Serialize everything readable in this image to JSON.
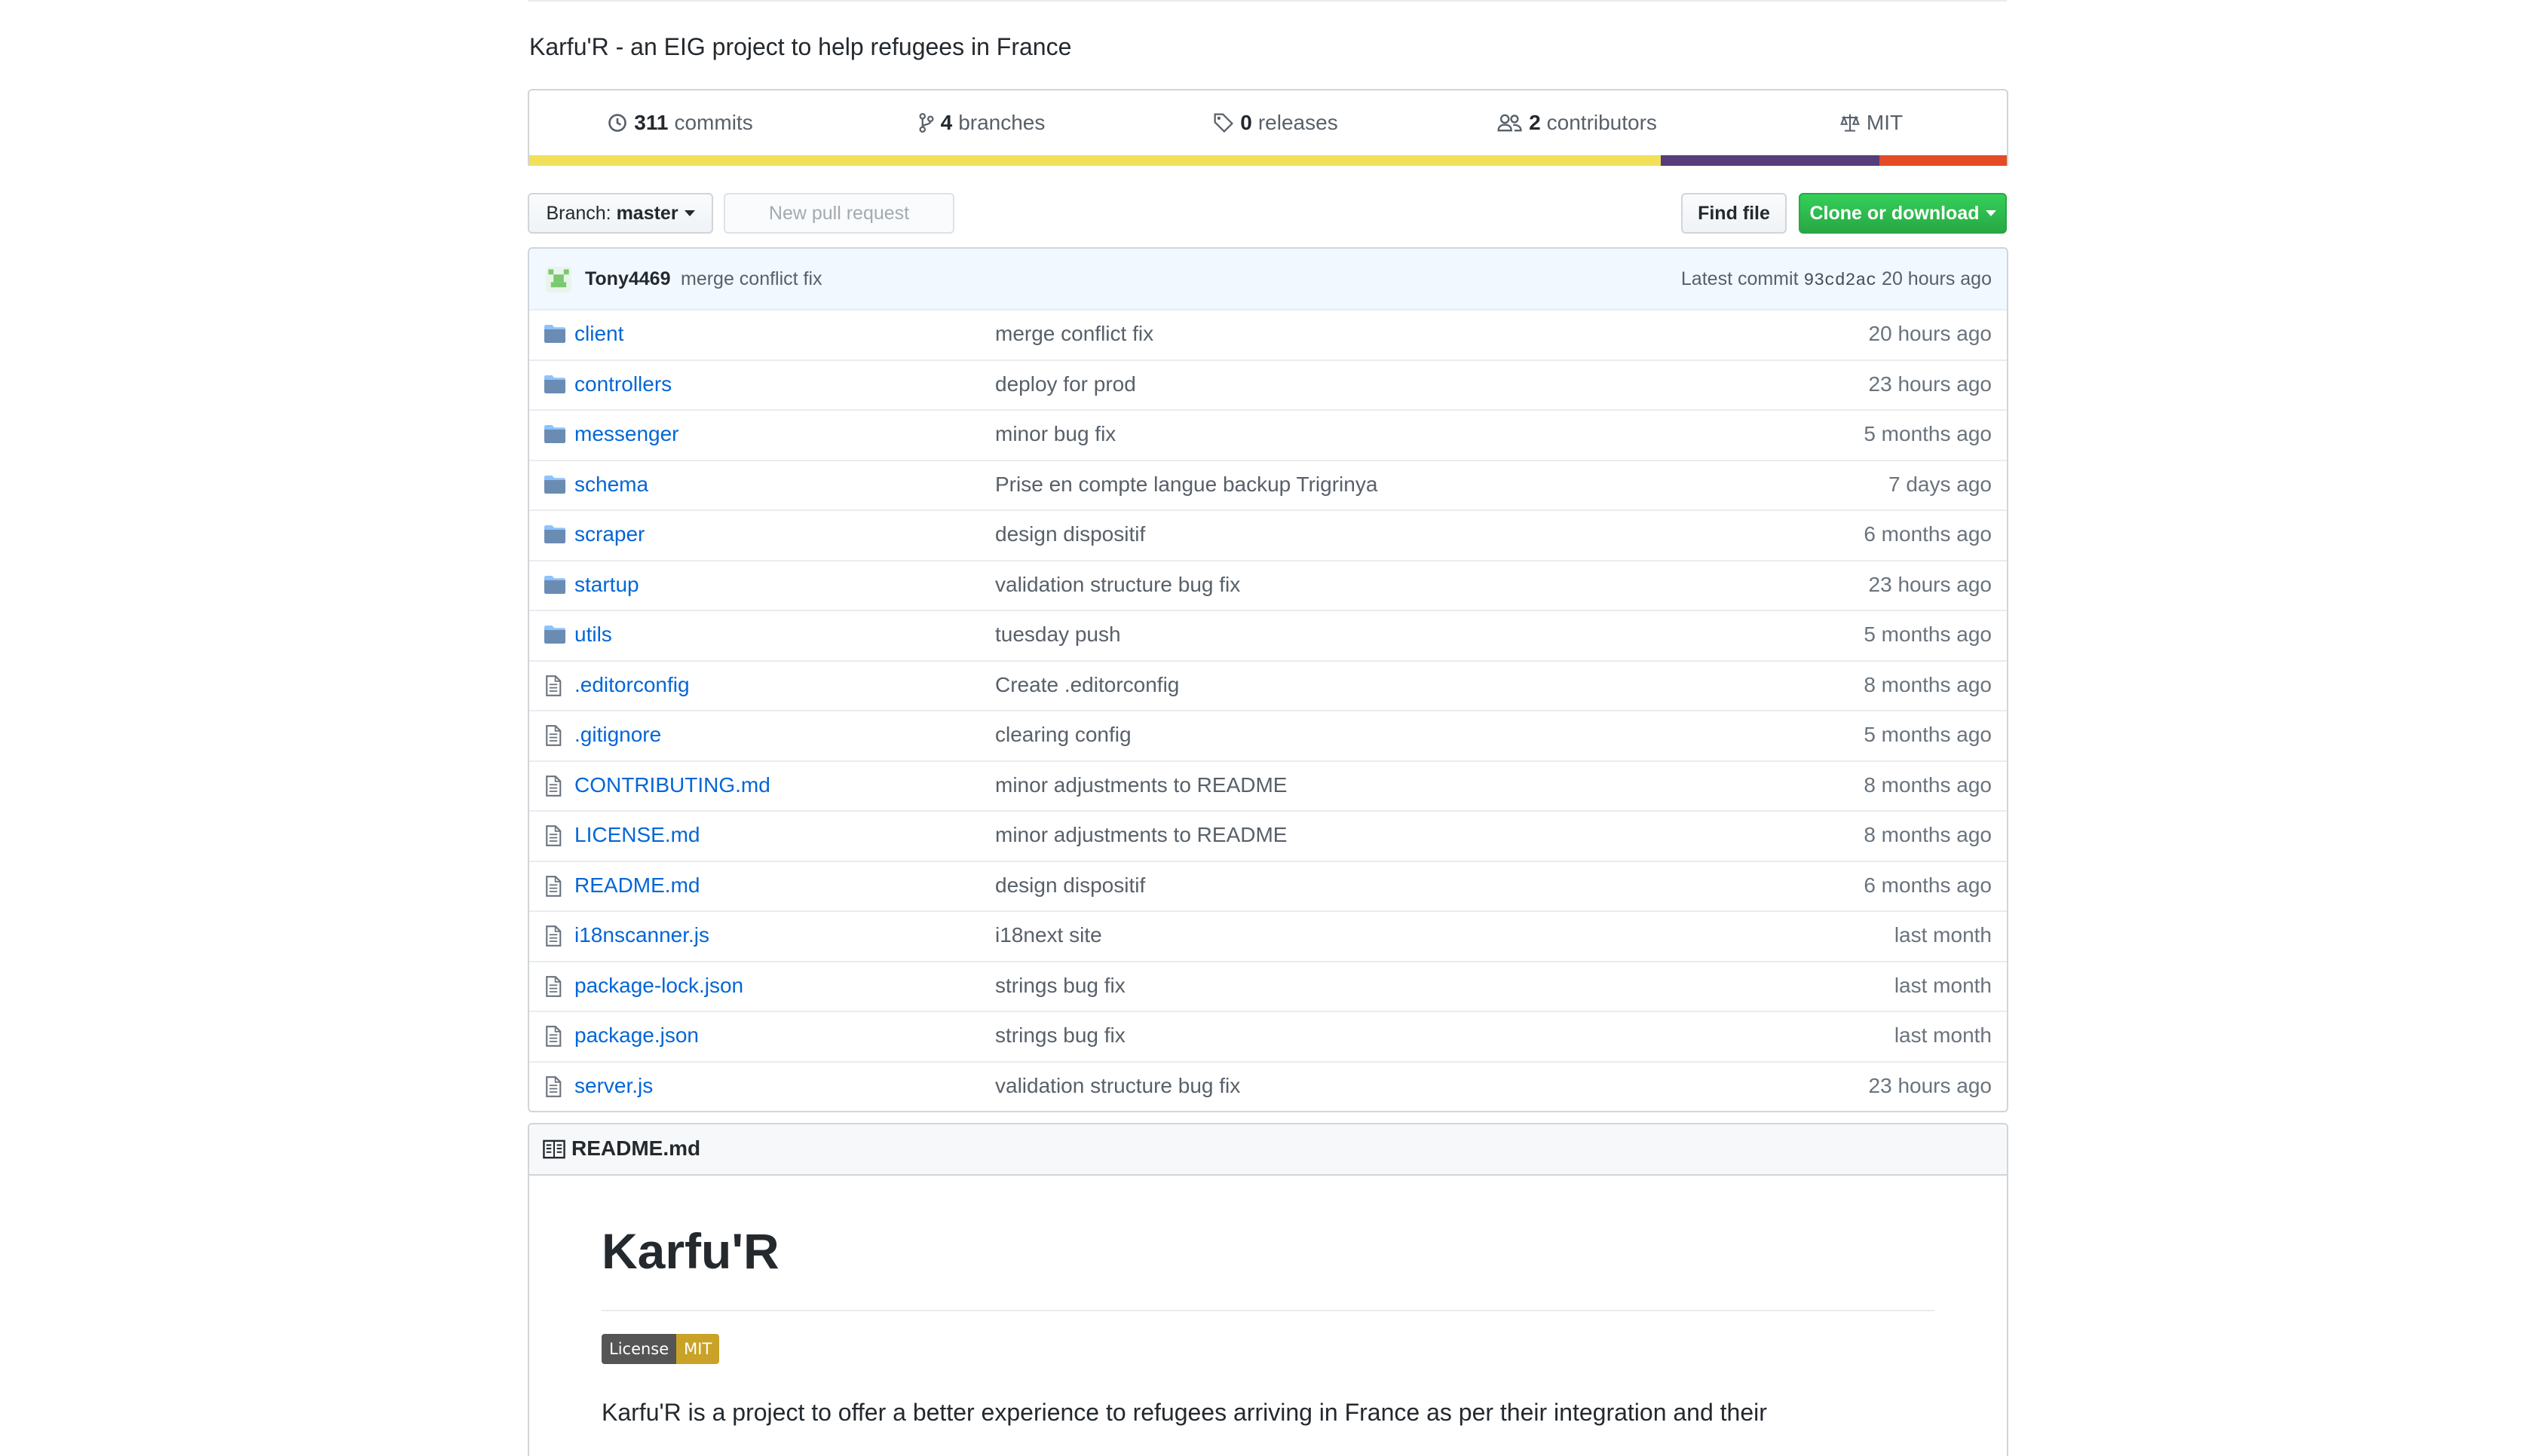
{
  "repo": {
    "description": "Karfu'R - an EIG project to help refugees in France"
  },
  "summary": {
    "commits": {
      "count": "311",
      "label": "commits"
    },
    "branches": {
      "count": "4",
      "label": "branches"
    },
    "releases": {
      "count": "0",
      "label": "releases"
    },
    "contributors": {
      "count": "2",
      "label": "contributors"
    },
    "license": "MIT"
  },
  "language_bar": [
    {
      "color": "#f1e05a",
      "fraction": 0.766
    },
    {
      "color": "#563d7c",
      "fraction": 0.148
    },
    {
      "color": "#e34c26",
      "fraction": 0.086
    }
  ],
  "toolbar": {
    "branch_prefix": "Branch:",
    "branch_name": "master",
    "new_pr": "New pull request",
    "find_file": "Find file",
    "clone": "Clone or download"
  },
  "latest_commit": {
    "author": "Tony4469",
    "message": "merge conflict fix",
    "label": "Latest commit",
    "sha": "93cd2ac",
    "age": "20 hours ago"
  },
  "files": [
    {
      "type": "dir",
      "name": "client",
      "message": "merge conflict fix",
      "age": "20 hours ago"
    },
    {
      "type": "dir",
      "name": "controllers",
      "message": "deploy for prod",
      "age": "23 hours ago"
    },
    {
      "type": "dir",
      "name": "messenger",
      "message": "minor bug fix",
      "age": "5 months ago"
    },
    {
      "type": "dir",
      "name": "schema",
      "message": "Prise en compte langue backup Trigrinya",
      "age": "7 days ago"
    },
    {
      "type": "dir",
      "name": "scraper",
      "message": "design dispositif",
      "age": "6 months ago"
    },
    {
      "type": "dir",
      "name": "startup",
      "message": "validation structure bug fix",
      "age": "23 hours ago"
    },
    {
      "type": "dir",
      "name": "utils",
      "message": "tuesday push",
      "age": "5 months ago"
    },
    {
      "type": "file",
      "name": ".editorconfig",
      "message": "Create .editorconfig",
      "age": "8 months ago"
    },
    {
      "type": "file",
      "name": ".gitignore",
      "message": "clearing config",
      "age": "5 months ago"
    },
    {
      "type": "file",
      "name": "CONTRIBUTING.md",
      "message": "minor adjustments to README",
      "age": "8 months ago"
    },
    {
      "type": "file",
      "name": "LICENSE.md",
      "message": "minor adjustments to README",
      "age": "8 months ago"
    },
    {
      "type": "file",
      "name": "README.md",
      "message": "design dispositif",
      "age": "6 months ago"
    },
    {
      "type": "file",
      "name": "i18nscanner.js",
      "message": "i18next site",
      "age": "last month"
    },
    {
      "type": "file",
      "name": "package-lock.json",
      "message": "strings bug fix",
      "age": "last month"
    },
    {
      "type": "file",
      "name": "package.json",
      "message": "strings bug fix",
      "age": "last month"
    },
    {
      "type": "file",
      "name": "server.js",
      "message": "validation structure bug fix",
      "age": "23 hours ago"
    }
  ],
  "readme": {
    "header": "README.md",
    "title": "Karfu'R",
    "badge_left": "License",
    "badge_right": "MIT",
    "paragraph": "Karfu'R is a project to offer a better experience to refugees arriving in France as per their integration and their"
  }
}
